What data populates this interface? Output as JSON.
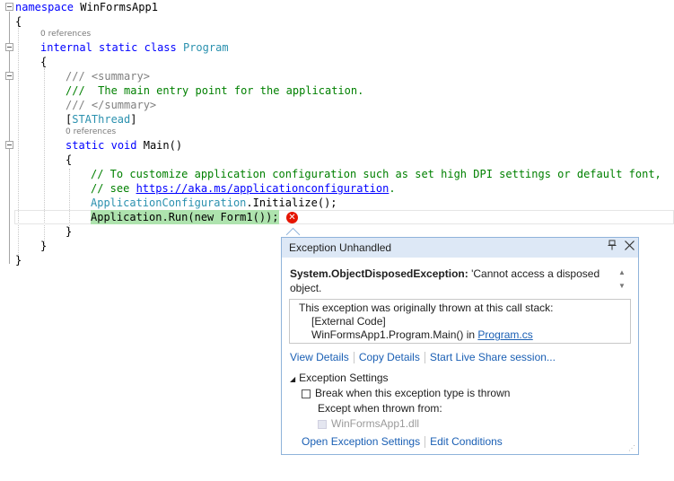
{
  "code": {
    "lines": [
      {
        "kw": "namespace",
        "rest": " WinFormsApp1"
      },
      {
        "text": "{"
      },
      {
        "codelens": "0 references"
      },
      {
        "kw1": "internal",
        "kw2": "static",
        "kw3": "class",
        "type": "Program"
      },
      {
        "text": "{"
      },
      {
        "xml1": "/// <summary>"
      },
      {
        "xml2": "///  The main entry point for the application."
      },
      {
        "xml3": "/// </summary>"
      },
      {
        "attr_open": "[",
        "attr": "STAThread",
        "attr_close": "]"
      },
      {
        "codelens": "0 references"
      },
      {
        "kw1": "static",
        "kw2": "void",
        "rest": " Main()"
      },
      {
        "text": "{"
      },
      {
        "comment1": "// To customize application configuration such as set high DPI settings or default font,"
      },
      {
        "comment2_pre": "// see ",
        "comment2_link": "https://aka.ms/applicationconfiguration",
        "comment2_post": "."
      },
      {
        "type": "ApplicationConfiguration",
        "rest": ".Initialize();"
      },
      {
        "highlight": "Application.Run(new Form1());"
      },
      {
        "text": "}"
      },
      {
        "text": "}"
      },
      {
        "text": "}"
      }
    ],
    "codelens_refs_class": "0 references",
    "codelens_refs_main": "0 references"
  },
  "popup": {
    "title": "Exception Unhandled",
    "pin_icon": "pin-icon",
    "close_icon": "close-icon",
    "exception_type": "System.ObjectDisposedException:",
    "exception_message_line1": " 'Cannot access a disposed",
    "exception_message_line2": "object.",
    "stack_header": "This exception was originally thrown at this call stack:",
    "stack_frame1": "[External Code]",
    "stack_frame2_pre": "WinFormsApp1.Program.Main() in ",
    "stack_frame2_link": "Program.cs",
    "link_view_details": "View Details",
    "link_copy_details": "Copy Details",
    "link_live_share": "Start Live Share session...",
    "settings_title": "Exception Settings",
    "break_checkbox_label": "Break when this exception type is thrown",
    "except_label": "Except when thrown from:",
    "dll_label": "WinFormsApp1.dll",
    "link_open_settings": "Open Exception Settings",
    "link_edit_conditions": "Edit Conditions"
  }
}
